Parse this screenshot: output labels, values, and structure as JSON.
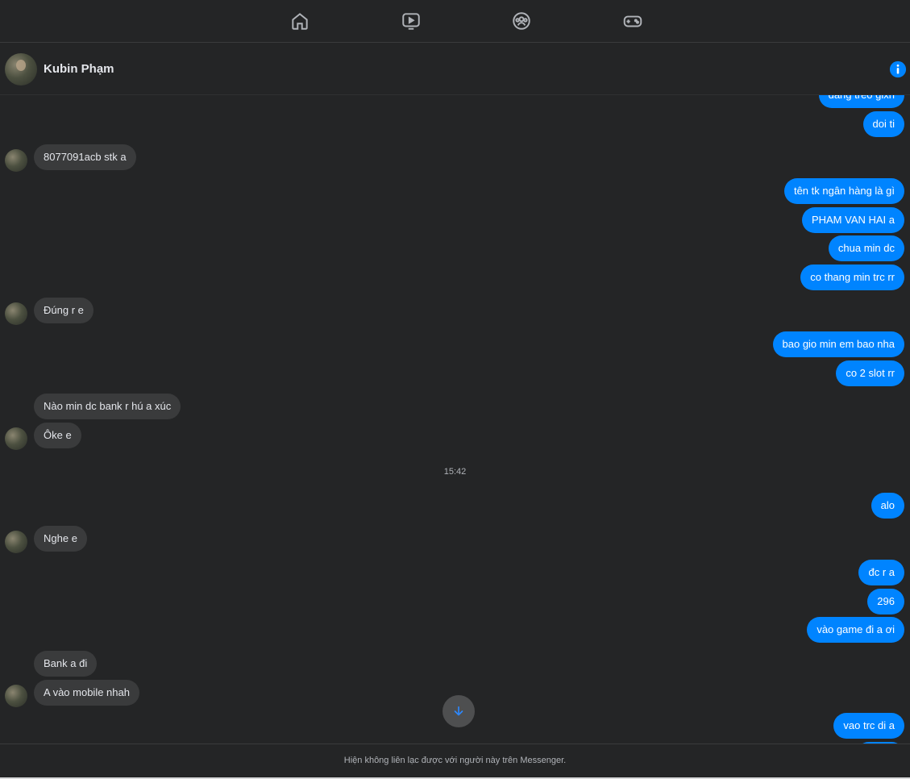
{
  "nav": {
    "icons": [
      "home-icon",
      "watch-icon",
      "groups-icon",
      "gaming-icon"
    ]
  },
  "header": {
    "contact_name": "Kubin Phạm"
  },
  "messages": [
    {
      "side": "out",
      "text": "dang treo gixh"
    },
    {
      "side": "out",
      "text": "doi ti"
    },
    {
      "side": "in",
      "text": "8077091acb stk a"
    },
    {
      "side": "out",
      "text": "tên tk ngân hàng là gì"
    },
    {
      "side": "out",
      "text": "PHAM VAN HAI a"
    },
    {
      "side": "out",
      "text": "chua min dc"
    },
    {
      "side": "out",
      "text": "co thang min trc rr"
    },
    {
      "side": "in",
      "text": "Đúng r e"
    },
    {
      "side": "out",
      "text": "bao gio min em bao nha"
    },
    {
      "side": "out",
      "text": "co 2 slot rr"
    },
    {
      "side": "in",
      "text": "Nào min dc bank r hú a xúc"
    },
    {
      "side": "in",
      "text": "Ôke e"
    },
    {
      "side": "time",
      "text": "15:42"
    },
    {
      "side": "out",
      "text": "alo"
    },
    {
      "side": "in",
      "text": "Nghe e"
    },
    {
      "side": "out",
      "text": "đc r a"
    },
    {
      "side": "out",
      "text": "296"
    },
    {
      "side": "out",
      "text": "vào game đi a ơi"
    },
    {
      "side": "in",
      "text": "Bank a đi"
    },
    {
      "side": "in",
      "text": "A vào mobile nhah"
    },
    {
      "side": "out",
      "text": "vao trc di a"
    }
  ],
  "footer": {
    "notice": "Hiện không liên lạc được với người này trên Messenger."
  },
  "colors": {
    "background": "#242526",
    "outgoing_bubble": "#0084ff",
    "incoming_bubble": "#3a3b3c",
    "accent": "#0084ff"
  }
}
